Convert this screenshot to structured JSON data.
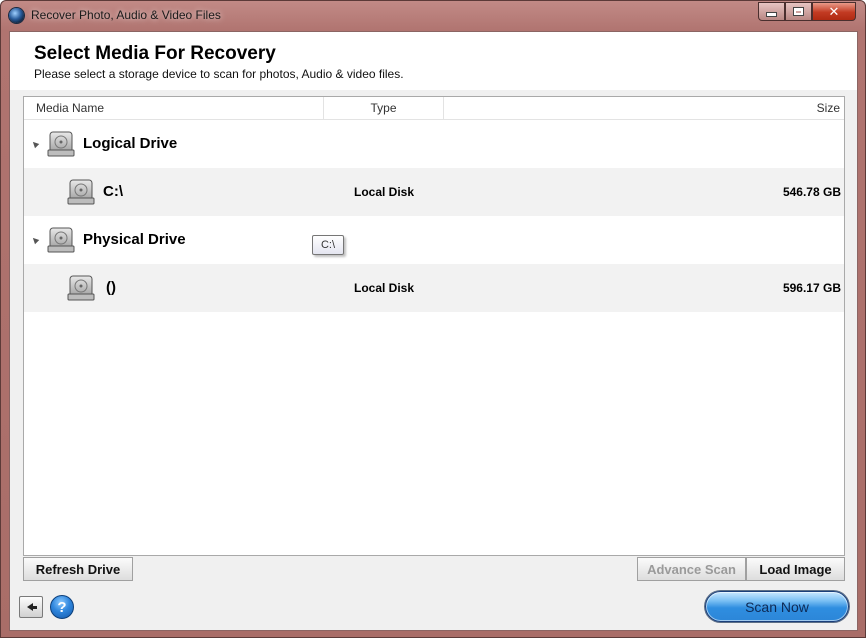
{
  "window": {
    "title": "Recover Photo, Audio & Video Files",
    "controls": {
      "minimize_icon": "minimize-icon",
      "maximize_icon": "maximize-icon",
      "close_icon": "close-icon",
      "close_label": "✕"
    }
  },
  "header": {
    "title": "Select Media For Recovery",
    "subtitle": "Please select a storage device to scan for photos, Audio & video files."
  },
  "columns": {
    "name": "Media Name",
    "type": "Type",
    "size": "Size"
  },
  "rows": [
    {
      "kind": "group",
      "name": "Logical Drive"
    },
    {
      "kind": "child",
      "name": "C:\\",
      "type": "Local Disk",
      "size": "546.78 GB"
    },
    {
      "kind": "group",
      "name": "Physical Drive"
    },
    {
      "kind": "child",
      "name": "()",
      "type": "Local Disk",
      "size": "596.17 GB"
    }
  ],
  "tooltip": {
    "text": "C:\\"
  },
  "buttons": {
    "refresh": "Refresh Drive",
    "advance_scan": "Advance Scan",
    "load_image": "Load Image",
    "help": "?",
    "scan_now": "Scan Now"
  },
  "colors": {
    "title_bar": "#b07470",
    "close_button": "#c23a22",
    "scan_button": "#2f8ee0"
  }
}
